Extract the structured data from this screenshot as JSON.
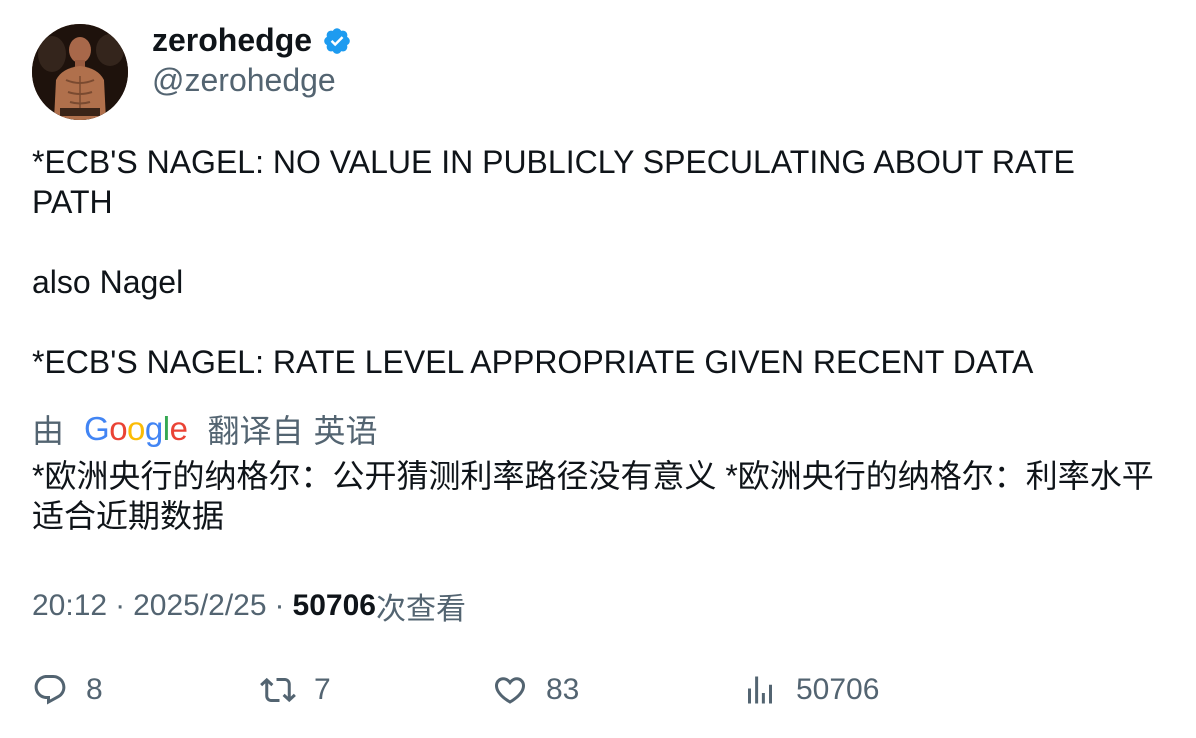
{
  "author": {
    "display_name": "zerohedge",
    "handle": "@zerohedge",
    "verified": true,
    "verified_color": "#1d9bf0"
  },
  "tweet": {
    "lines": [
      "*ECB'S NAGEL: NO VALUE IN PUBLICLY SPECULATING ABOUT RATE PATH",
      "also Nagel",
      "*ECB'S NAGEL: RATE LEVEL APPROPRIATE GIVEN RECENT DATA"
    ]
  },
  "translation": {
    "prefix": "由",
    "provider": "Google",
    "suffix": "翻译自",
    "language": "英语",
    "text": "*欧洲央行的纳格尔：公开猜测利率路径没有意义 *欧洲央行的纳格尔：利率水平适合近期数据"
  },
  "meta": {
    "time": "20:12",
    "date": "2025/2/25",
    "views_count": "50706",
    "views_label": "次查看"
  },
  "actions": {
    "replies": "8",
    "retweets": "7",
    "likes": "83",
    "views": "50706"
  },
  "icons": {
    "reply": "reply-icon",
    "retweet": "retweet-icon",
    "like": "heart-icon",
    "views": "views-bar-chart-icon",
    "verified": "verified-badge-icon"
  }
}
